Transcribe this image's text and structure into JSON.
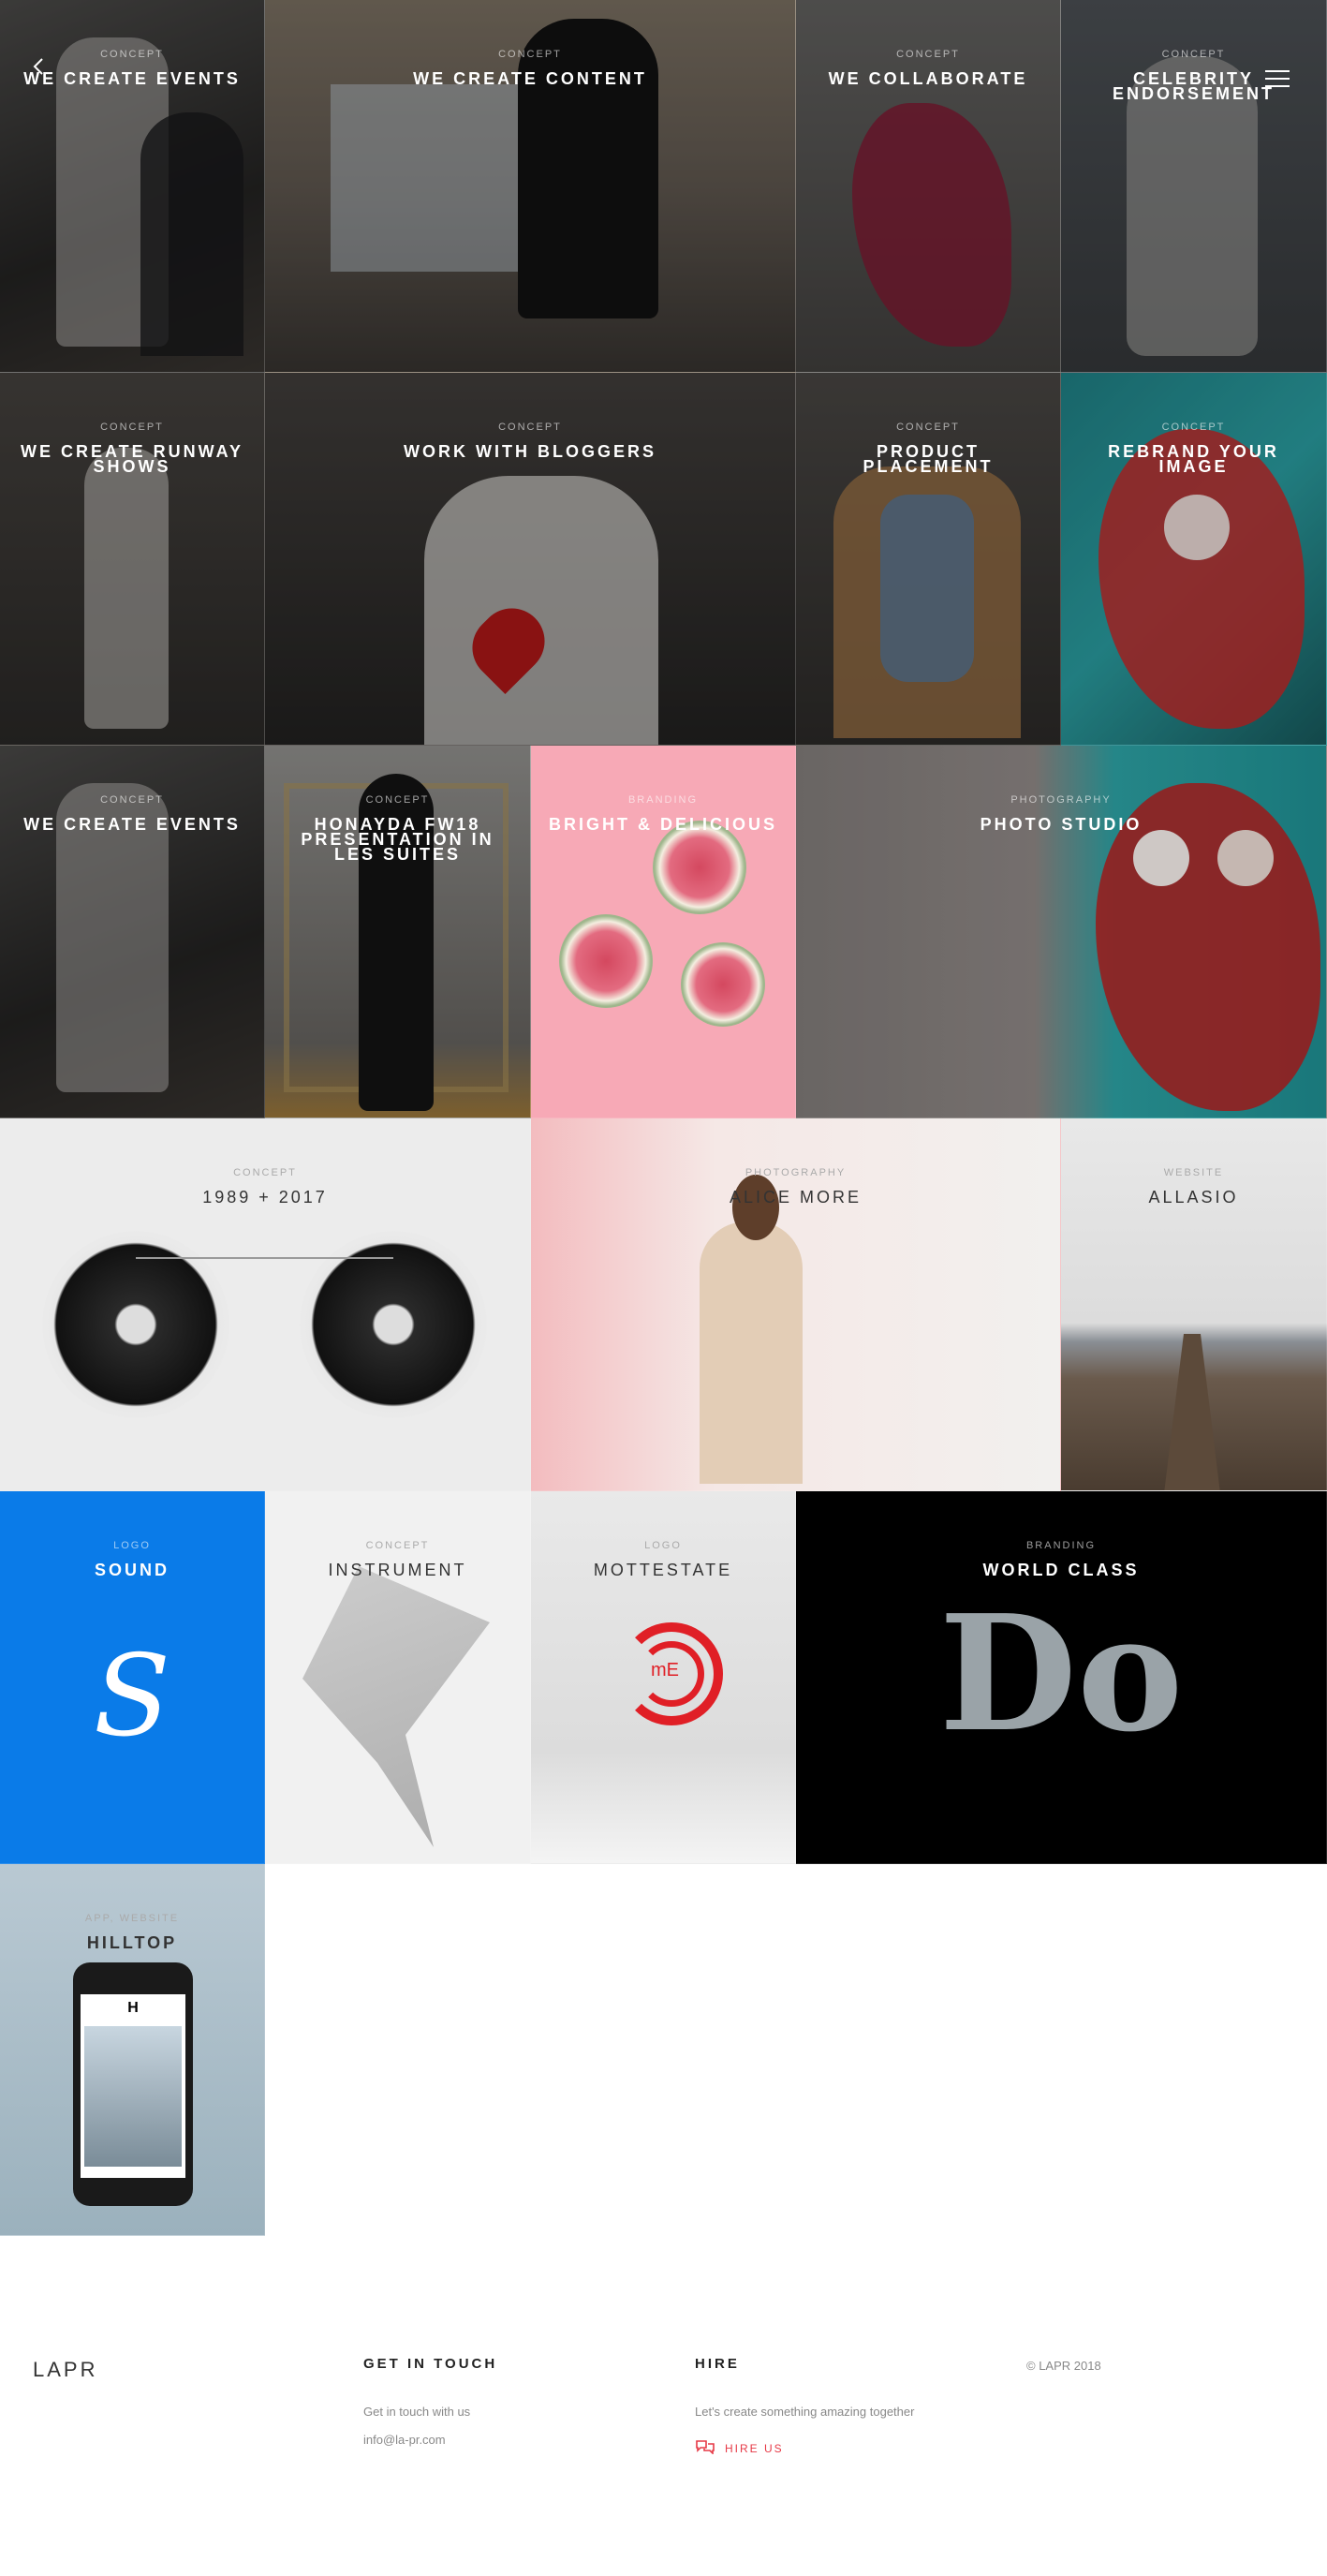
{
  "tiles": [
    {
      "category": "Concept",
      "title": "We create events"
    },
    {
      "category": "Concept",
      "title": "We create content"
    },
    {
      "category": "Concept",
      "title": "We collaborate"
    },
    {
      "category": "Concept",
      "title": "Celebrity endorsement"
    },
    {
      "category": "Concept",
      "title": "We create runway shows"
    },
    {
      "category": "Concept",
      "title": "Work with bloggers"
    },
    {
      "category": "Concept",
      "title": "Product placement"
    },
    {
      "category": "Concept",
      "title": "Rebrand your image"
    },
    {
      "category": "Concept",
      "title": "We create events"
    },
    {
      "category": "Concept",
      "title": "Honayda FW18 presentation in Les Suites"
    },
    {
      "category": "Branding",
      "title": "Bright & Delicious"
    },
    {
      "category": "Photography",
      "title": "Photo studio"
    },
    {
      "category": "Concept",
      "title": "1989 + 2017"
    },
    {
      "category": "Photography",
      "title": "Alice More"
    },
    {
      "category": "Website",
      "title": "Allasio"
    },
    {
      "category": "Logo",
      "title": "Sound"
    },
    {
      "category": "Concept",
      "title": "Instrument"
    },
    {
      "category": "Logo",
      "title": "Mottestate"
    },
    {
      "category": "Branding",
      "title": "World Class"
    },
    {
      "category": "App, Website",
      "title": "Hilltop"
    }
  ],
  "art": {
    "sound_letter": "S",
    "mottestate_mark": "mE",
    "world_class_word": "Do",
    "hilltop_app_letter": "H"
  },
  "footer": {
    "logo": "LAPR",
    "contact_heading": "Get in touch",
    "contact_text": "Get in touch with us",
    "contact_email": "info@la-pr.com",
    "hire_heading": "Hire",
    "hire_text": "Let's create something amazing together",
    "hire_link": "HIRE US",
    "copyright": "© LAPR 2018"
  },
  "colors": {
    "accent": "#e63946",
    "sound_blue": "#0a7be8",
    "fig_pink": "#f7a9b6"
  },
  "icons": {
    "back": "chevron-left-icon",
    "menu": "hamburger-menu-icon",
    "hire": "chat-bubbles-icon"
  }
}
